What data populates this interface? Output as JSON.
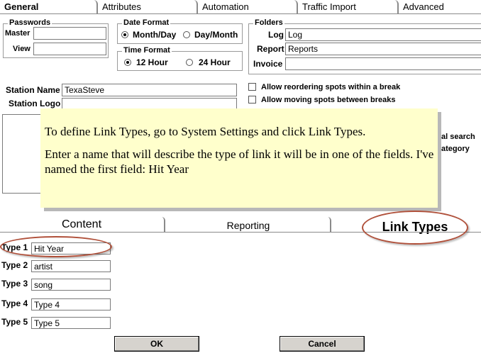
{
  "tabs": [
    {
      "label": "General"
    },
    {
      "label": "Attributes"
    },
    {
      "label": "Automation"
    },
    {
      "label": "Traffic Import"
    },
    {
      "label": "Advanced"
    }
  ],
  "passwords": {
    "title": "Passwords",
    "master_label": "Master",
    "view_label": "View"
  },
  "date_format": {
    "title": "Date Format",
    "opt1": "Month/Day",
    "opt2": "Day/Month"
  },
  "time_format": {
    "title": "Time Format",
    "opt1": "12 Hour",
    "opt2": "24 Hour"
  },
  "folders": {
    "title": "Folders",
    "log_label": "Log",
    "log_value": "Log",
    "report_label": "Report",
    "report_value": "Reports",
    "invoice_label": "Invoice"
  },
  "station": {
    "name_label": "Station Name",
    "name_value": "TexaSteve",
    "logo_label": "Station Logo"
  },
  "checks": {
    "reorder": "Allow reordering spots within a break",
    "moving": "Allow moving spots between breaks"
  },
  "behind": {
    "a": "al search",
    "b": "ategory"
  },
  "callout": {
    "line1": "To define Link Types, go to System Settings and click Link Types.",
    "line2": "Enter a name that will describe the type of link it will be in one of the fields.  I've named the first field: Hit Year"
  },
  "bottom_tabs": {
    "content": "Content",
    "reporting": "Reporting",
    "link_types": "Link Types"
  },
  "types": [
    {
      "label": "Type 1",
      "value": "Hit Year"
    },
    {
      "label": "Type 2",
      "value": "artist"
    },
    {
      "label": "Type 3",
      "value": "song"
    },
    {
      "label": "Type 4",
      "value": "Type 4"
    },
    {
      "label": "Type 5",
      "value": "Type 5"
    }
  ],
  "buttons": {
    "ok": "OK",
    "cancel": "Cancel"
  },
  "colors": {
    "callout_bg": "#ffffcc",
    "highlight_ring": "#b0503a",
    "button_face": "#d6d3ce"
  }
}
